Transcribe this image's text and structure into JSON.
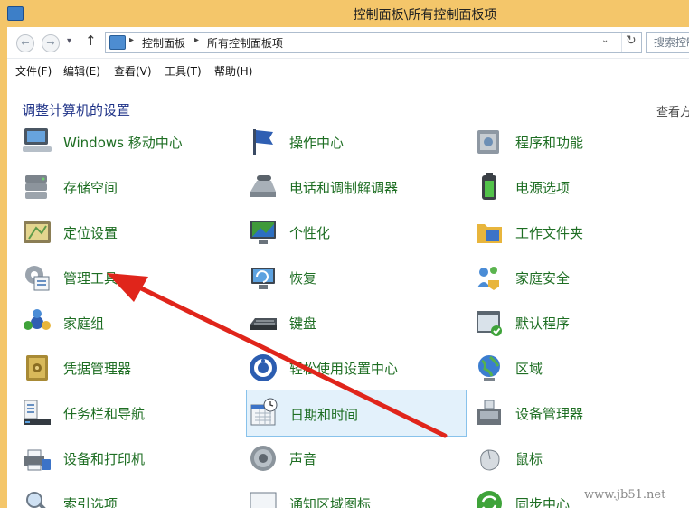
{
  "window": {
    "title": "控制面板\\所有控制面板项"
  },
  "address": {
    "crumbs": [
      "控制面板",
      "所有控制面板项"
    ]
  },
  "search": {
    "placeholder": "搜索控制"
  },
  "menu": [
    "文件(F)",
    "编辑(E)",
    "查看(V)",
    "工具(T)",
    "帮助(H)"
  ],
  "content": {
    "heading": "调整计算机的设置",
    "view_by": "查看方"
  },
  "items": [
    {
      "label": "Windows 移动中心",
      "icon": "mobility-center-icon"
    },
    {
      "label": "操作中心",
      "icon": "action-center-flag-icon"
    },
    {
      "label": "程序和功能",
      "icon": "programs-features-icon"
    },
    {
      "label": "存储空间",
      "icon": "storage-spaces-icon"
    },
    {
      "label": "电话和调制解调器",
      "icon": "phone-modem-icon"
    },
    {
      "label": "电源选项",
      "icon": "power-options-icon"
    },
    {
      "label": "定位设置",
      "icon": "location-settings-icon"
    },
    {
      "label": "个性化",
      "icon": "personalization-icon"
    },
    {
      "label": "工作文件夹",
      "icon": "work-folders-icon"
    },
    {
      "label": "管理工具",
      "icon": "admin-tools-icon"
    },
    {
      "label": "恢复",
      "icon": "recovery-icon"
    },
    {
      "label": "家庭安全",
      "icon": "family-safety-icon"
    },
    {
      "label": "家庭组",
      "icon": "homegroup-icon"
    },
    {
      "label": "键盘",
      "icon": "keyboard-icon"
    },
    {
      "label": "默认程序",
      "icon": "default-programs-icon"
    },
    {
      "label": "凭据管理器",
      "icon": "credential-manager-icon"
    },
    {
      "label": "轻松使用设置中心",
      "icon": "ease-of-access-icon"
    },
    {
      "label": "区域",
      "icon": "region-globe-icon"
    },
    {
      "label": "任务栏和导航",
      "icon": "taskbar-navigation-icon"
    },
    {
      "label": "日期和时间",
      "icon": "date-time-icon"
    },
    {
      "label": "设备管理器",
      "icon": "device-manager-icon"
    },
    {
      "label": "设备和打印机",
      "icon": "devices-printers-icon"
    },
    {
      "label": "声音",
      "icon": "sound-speaker-icon"
    },
    {
      "label": "鼠标",
      "icon": "mouse-icon"
    },
    {
      "label": "索引选项",
      "icon": "indexing-options-icon"
    },
    {
      "label": "通知区域图标",
      "icon": "notification-icons-icon"
    },
    {
      "label": "同步中心",
      "icon": "sync-center-icon"
    }
  ],
  "selected_item": "日期和时间",
  "watermark": "www.jb51.net",
  "colors": {
    "title_bar": "#f4c66a",
    "link_text": "#1e6e23",
    "heading": "#1e3287",
    "arrow": "#e0251b",
    "selection": "#e3f1fb"
  }
}
